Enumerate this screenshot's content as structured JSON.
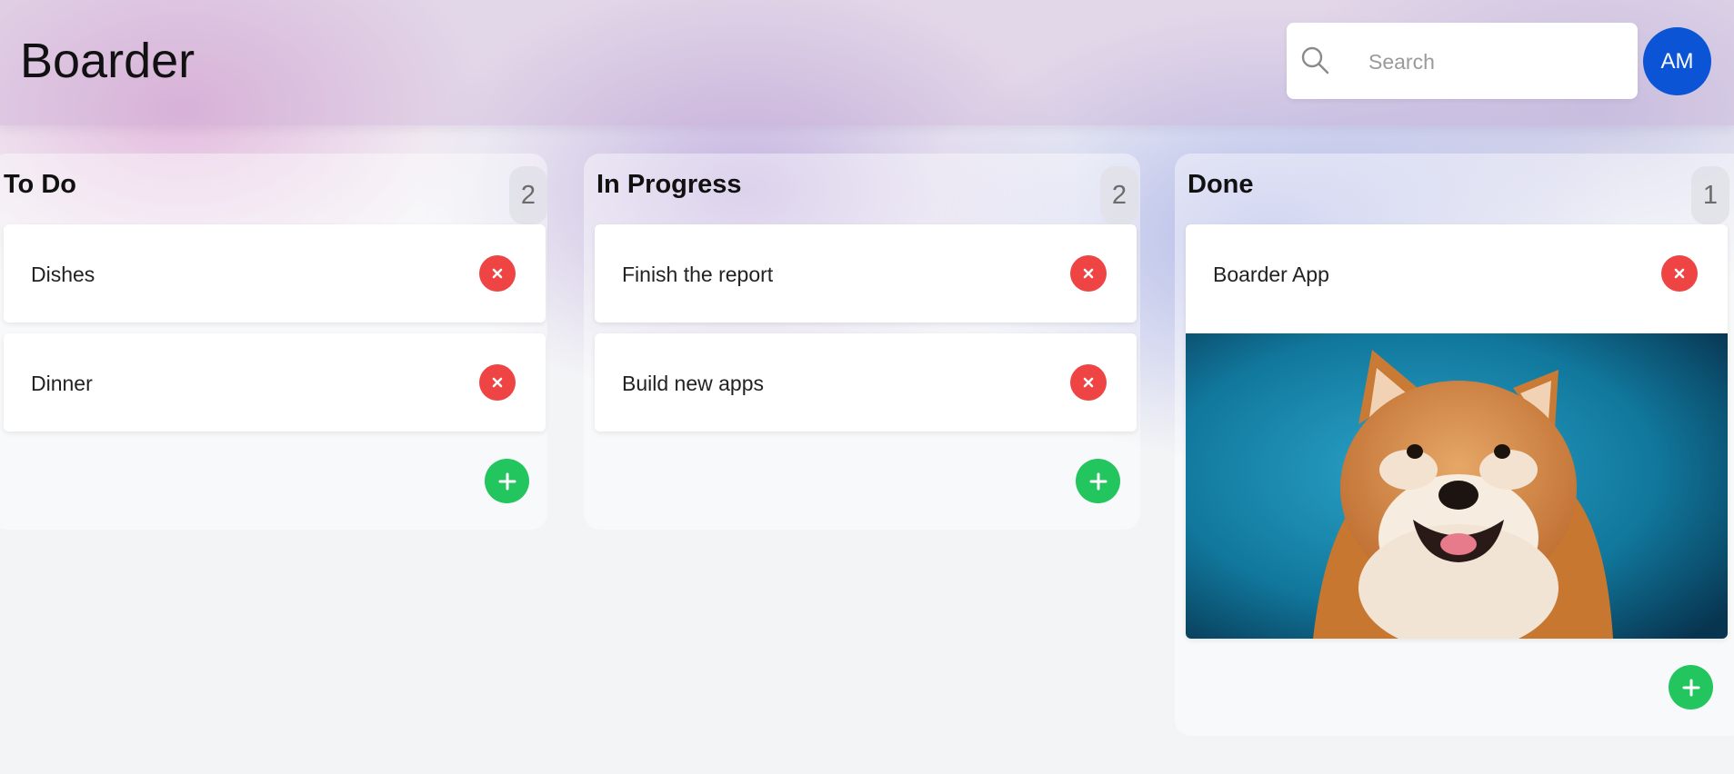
{
  "app": {
    "title": "Boarder"
  },
  "search": {
    "placeholder": "Search",
    "value": ""
  },
  "user": {
    "initials": "AM"
  },
  "columns": [
    {
      "title": "To Do",
      "count": "2",
      "cards": [
        {
          "label": "Dishes"
        },
        {
          "label": "Dinner"
        }
      ]
    },
    {
      "title": "In Progress",
      "count": "2",
      "cards": [
        {
          "label": "Finish the report"
        },
        {
          "label": "Build new apps"
        }
      ]
    },
    {
      "title": "Done",
      "count": "1",
      "cards": [
        {
          "label": "Boarder App",
          "image": "shiba-inu-dog-photo"
        }
      ]
    }
  ],
  "icons": {
    "search": "search-icon",
    "delete": "close-icon",
    "add": "plus-icon"
  },
  "colors": {
    "avatar": "#0b54d6",
    "delete": "#ee4444",
    "add": "#22c55e"
  }
}
